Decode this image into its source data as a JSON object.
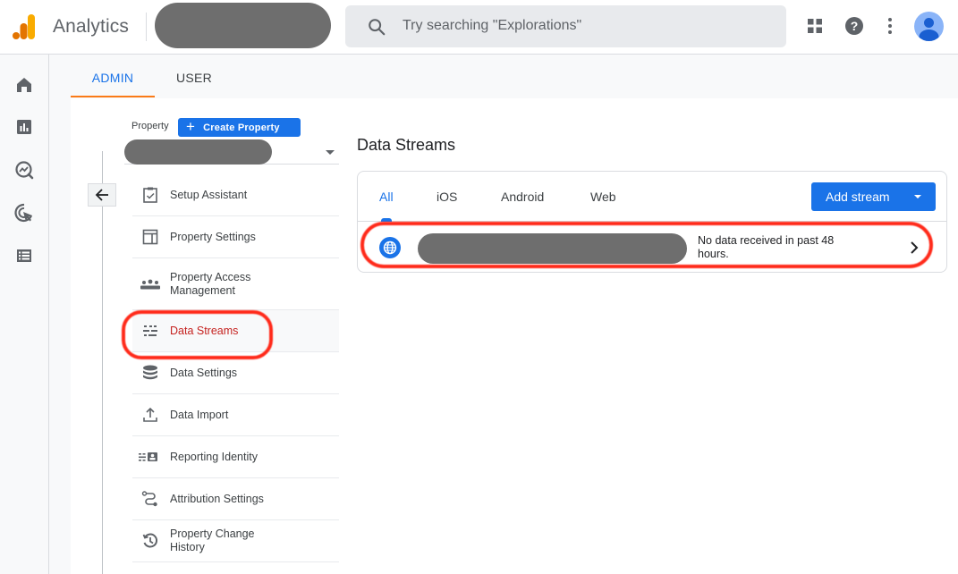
{
  "header": {
    "app_title": "Analytics",
    "account_selector": "[redacted]",
    "search_placeholder": "Try searching \"Explorations\"",
    "icons": [
      "apps-grid-icon",
      "help-icon",
      "more-vert-icon",
      "account-avatar"
    ]
  },
  "rail": {
    "items": [
      {
        "name": "home",
        "icon": "home-icon"
      },
      {
        "name": "reports",
        "icon": "bar-chart-icon"
      },
      {
        "name": "explore",
        "icon": "explore-trend-icon"
      },
      {
        "name": "advertising",
        "icon": "ads-cursor-icon"
      },
      {
        "name": "configure",
        "icon": "list-icon"
      }
    ]
  },
  "admin_tabs": [
    {
      "label": "ADMIN",
      "active": true
    },
    {
      "label": "USER",
      "active": false
    }
  ],
  "property": {
    "label": "Property",
    "create_button": "Create Property",
    "selected_value": "[redacted]"
  },
  "nav": {
    "items": [
      {
        "label": "Setup Assistant",
        "icon": "clipboard-check-icon",
        "selected": false
      },
      {
        "label": "Property Settings",
        "icon": "layout-icon",
        "selected": false
      },
      {
        "label": "Property Access Management",
        "icon": "people-icon",
        "selected": false
      },
      {
        "label": "Data Streams",
        "icon": "streams-icon",
        "selected": true
      },
      {
        "label": "Data Settings",
        "icon": "database-icon",
        "selected": false
      },
      {
        "label": "Data Import",
        "icon": "upload-icon",
        "selected": false
      },
      {
        "label": "Reporting Identity",
        "icon": "reporting-identity-icon",
        "selected": false
      },
      {
        "label": "Attribution Settings",
        "icon": "attribution-path-icon",
        "selected": false
      },
      {
        "label": "Property Change History",
        "icon": "history-icon",
        "selected": false
      }
    ]
  },
  "data_streams": {
    "title": "Data Streams",
    "tabs": [
      {
        "label": "All",
        "active": true
      },
      {
        "label": "iOS",
        "active": false
      },
      {
        "label": "Android",
        "active": false
      },
      {
        "label": "Web",
        "active": false
      }
    ],
    "add_button": "Add stream",
    "rows": [
      {
        "type": "web",
        "name": "[redacted]",
        "status": "No data received in past 48 hours."
      }
    ]
  },
  "colors": {
    "accent_blue": "#1a73e8",
    "selected_red": "#c5221f",
    "tab_underline_orange": "#fa7b17",
    "annotation_red": "#ff2a1a"
  }
}
